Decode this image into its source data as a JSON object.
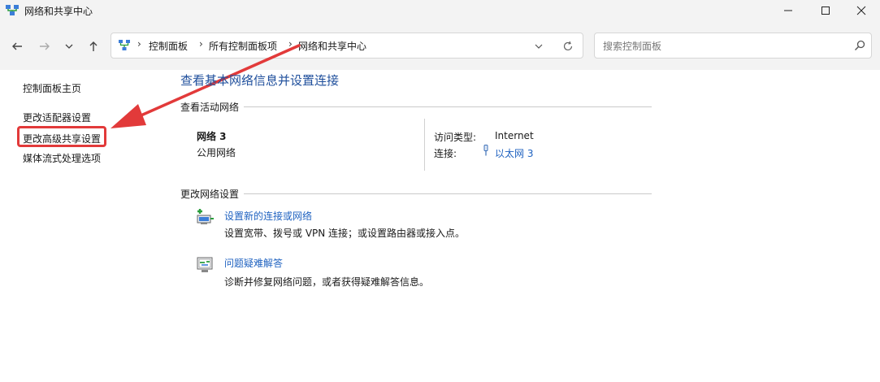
{
  "window": {
    "title": "网络和共享中心",
    "icon": "network-icon"
  },
  "address_bar": {
    "breadcrumbs": [
      "控制面板",
      "所有控制面板项",
      "网络和共享中心"
    ],
    "separator": "›"
  },
  "search": {
    "placeholder": "搜索控制面板"
  },
  "sidebar": {
    "items": [
      {
        "label": "控制面板主页"
      },
      {
        "label": "更改适配器设置"
      },
      {
        "label": "更改高级共享设置"
      },
      {
        "label": "媒体流式处理选项"
      }
    ]
  },
  "main": {
    "title": "查看基本网络信息并设置连接",
    "active_networks": {
      "header": "查看活动网络",
      "network_name": "网络 3",
      "network_type": "公用网络",
      "access_type_label": "访问类型:",
      "access_type_value": "Internet",
      "connection_label": "连接:",
      "connection_value": "以太网 3"
    },
    "change_settings": {
      "header": "更改网络设置",
      "tasks": [
        {
          "title": "设置新的连接或网络",
          "description": "设置宽带、拨号或 VPN 连接；或设置路由器或接入点。",
          "icon": "new-connection-icon"
        },
        {
          "title": "问题疑难解答",
          "description": "诊断并修复网络问题，或者获得疑难解答信息。",
          "icon": "troubleshoot-icon"
        }
      ]
    }
  },
  "colors": {
    "link": "#1f62c0",
    "title": "#1f4f9c",
    "annotation": "#e23a3a"
  }
}
